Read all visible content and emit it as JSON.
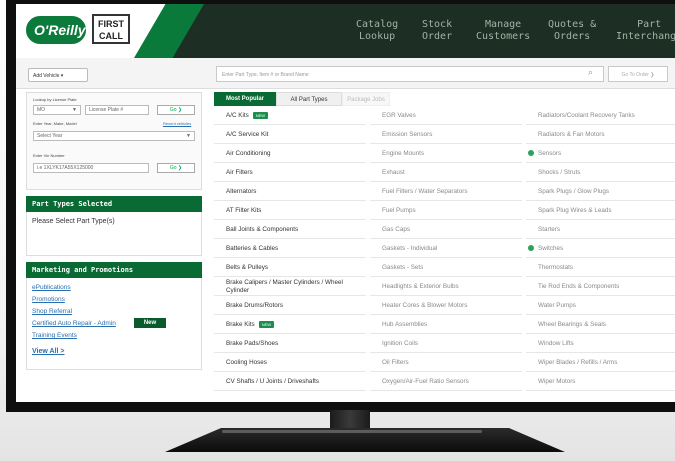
{
  "nav": [
    {
      "label": "Catalog\nLookup"
    },
    {
      "label": "Stock\nOrder"
    },
    {
      "label": "Manage\nCustomers"
    },
    {
      "label": "Quotes &\nOrders"
    },
    {
      "label": "Part\nInterchange"
    }
  ],
  "brand": {
    "oreilly": "O'Reilly",
    "firstcall": "FIRST CALL"
  },
  "search": {
    "add_vehicle": "Add Vehicle ▾",
    "placeholder": "Enter Part Type, Item # or Brand Name",
    "goto": "Go To Order ❯"
  },
  "lookup": {
    "plate_label": "Lookup by License Plate",
    "state_value": "MO",
    "plate_placeholder": "License Plate #",
    "go": "Go ❯",
    "ymm_label": "Enter Year, Make, Model",
    "recent_link": "Recent vehicles",
    "year_placeholder": "Select Year",
    "vin_label": "Enter Vin Number",
    "vin_placeholder": "i.e 1XLYK17A55X125000"
  },
  "part_types_selected": {
    "title": "Part Types Selected",
    "message": "Please Select Part Type(s)"
  },
  "marketing": {
    "title": "Marketing and Promotions",
    "links": [
      "ePublications",
      "Promotions",
      "Shop Referral",
      "Certified Auto Repair - Admin",
      "Training Events"
    ],
    "new_badge": "New",
    "view_all": "View All >"
  },
  "tabs": [
    "Most Popular",
    "All Part Types",
    "Package Jobs"
  ],
  "kit_badge": "NEW",
  "columns": [
    [
      "A/C Kits",
      "A/C Service Kit",
      "Air Conditioning",
      "Air Filters",
      "Alternators",
      "AT Filter Kits",
      "Ball Joints & Components",
      "Batteries & Cables",
      "Belts & Pulleys",
      "Brake Calipers / Master Cylinders / Wheel Cylinder",
      "Brake Drums/Rotors",
      "Brake Kits",
      "Brake Pads/Shoes",
      "Cooling Hoses",
      "CV Shafts / U Joints / Driveshafts"
    ],
    [
      "EGR Valves",
      "Emission Sensors",
      "Engine Mounts",
      "Exhaust",
      "Fuel Filters / Water Separators",
      "Fuel Pumps",
      "Gas Caps",
      "Gaskets - Individual",
      "Gaskets - Sets",
      "Headlights & Exterior Bulbs",
      "Heater Cores & Blower Motors",
      "Hub Assemblies",
      "Ignition Coils",
      "Oil Filters",
      "Oxygen/Air-Fuel Ratio Sensors"
    ],
    [
      "Radiators/Coolant Recovery Tanks",
      "Radiators & Fan Motors",
      "Sensors",
      "Shocks / Struts",
      "Spark Plugs / Glow Plugs",
      "Spark Plug Wires & Leads",
      "Starters",
      "Switches",
      "Thermostats",
      "Tie Rod Ends & Components",
      "Water Pumps",
      "Wheel Bearings & Seals",
      "Window Lifts",
      "Wiper Blades / Refills / Arms",
      "Wiper Motors"
    ]
  ]
}
